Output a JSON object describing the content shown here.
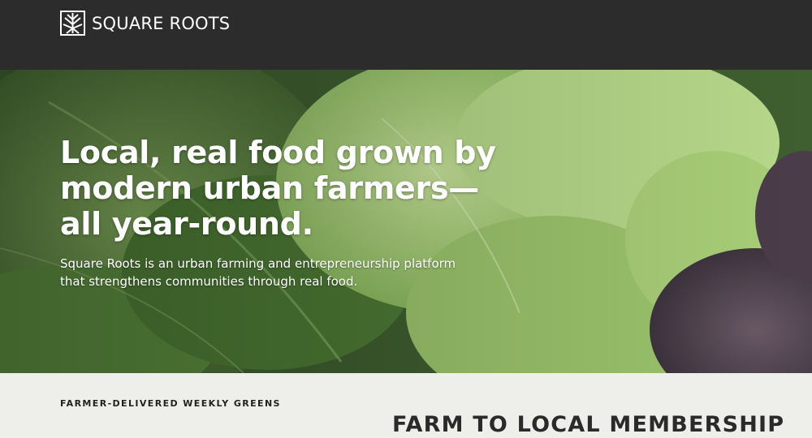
{
  "header": {
    "brand": "SQUARE ROOTS",
    "logo_icon": "square-roots-logo-icon",
    "background": "#2c2c2c"
  },
  "hero": {
    "title_lines": [
      "Local, real food grown by",
      "modern urban farmers—",
      "all year-round."
    ],
    "subtitle_lines": [
      "Square Roots is an urban farming and entrepreneurship platform",
      "that strengthens communities through real food."
    ],
    "image": "leafy-greens-photo"
  },
  "band": {
    "eyebrow": "FARMER-DELIVERED WEEKLY GREENS",
    "title": "FARM TO LOCAL MEMBERSHIP",
    "background": "#eeeeea"
  }
}
